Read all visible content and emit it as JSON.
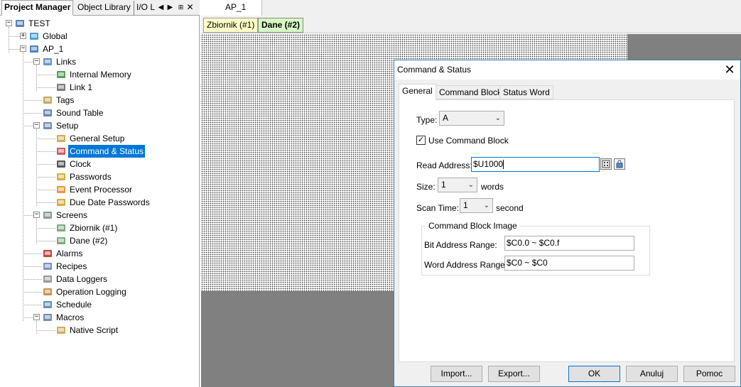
{
  "left_panel": {
    "tabs": [
      "Project Manager",
      "Object Library",
      "I/O L"
    ],
    "pin_glyph": "⌂",
    "tree": [
      {
        "label": "TEST",
        "expander": "−",
        "icon": "project-icon"
      },
      {
        "label": "Global",
        "expander": "+",
        "icon": "globe-icon"
      },
      {
        "label": "AP_1",
        "expander": "−",
        "icon": "monitor-icon"
      },
      {
        "label": "Links",
        "expander": "−",
        "icon": "links-icon"
      },
      {
        "label": "Internal Memory",
        "icon": "memory-icon"
      },
      {
        "label": "Link 1",
        "icon": "plc-icon"
      },
      {
        "label": "Tags",
        "icon": "tags-icon"
      },
      {
        "label": "Sound Table",
        "icon": "sound-icon"
      },
      {
        "label": "Setup",
        "expander": "−",
        "icon": "gears-icon"
      },
      {
        "label": "General Setup",
        "icon": "setup-icon"
      },
      {
        "label": "Command & Status",
        "icon": "command-icon",
        "selected": true
      },
      {
        "label": "Clock",
        "icon": "clock-icon"
      },
      {
        "label": "Passwords",
        "icon": "key-icon"
      },
      {
        "label": "Event Processor",
        "icon": "lightning-icon"
      },
      {
        "label": "Due Date Passwords",
        "icon": "key-icon"
      },
      {
        "label": "Screens",
        "expander": "−",
        "icon": "screens-icon"
      },
      {
        "label": "Zbiornik (#1)",
        "icon": "screen-icon"
      },
      {
        "label": "Dane (#2)",
        "icon": "screen-icon"
      },
      {
        "label": "Alarms",
        "icon": "alarm-icon"
      },
      {
        "label": "Recipes",
        "icon": "recipes-icon"
      },
      {
        "label": "Data Loggers",
        "icon": "logger-icon"
      },
      {
        "label": "Operation Logging",
        "icon": "oplog-icon"
      },
      {
        "label": "Schedule",
        "icon": "schedule-icon"
      },
      {
        "label": "Macros",
        "expander": "−",
        "icon": "macros-icon"
      },
      {
        "label": "Native Script",
        "icon": "script-icon"
      }
    ]
  },
  "document": {
    "tab": "AP_1",
    "screen_tabs": [
      "Zbiornik (#1)",
      "Dane (#2)"
    ]
  },
  "dialog": {
    "title": "Command & Status",
    "tabs": [
      "General",
      "Command Block",
      "Status Word"
    ],
    "type_label": "Type:",
    "type_value": "A",
    "use_command_block_label": "Use Command Block",
    "use_command_block_checked": true,
    "read_address_label": "Read Address:",
    "read_address_value": "$U1000",
    "size_label": "Size:",
    "size_value": "1",
    "size_unit": "words",
    "scan_time_label": "Scan Time:",
    "scan_time_value": "1",
    "scan_time_unit": "second",
    "group_title": "Command Block Image",
    "bit_range_label": "Bit Address Range:",
    "bit_range_value": "$C0.0 ~ $C0.f",
    "word_range_label": "Word Address Range:",
    "word_range_value": "$C0 ~ $C0",
    "buttons": {
      "import": "Import...",
      "export": "Export...",
      "ok": "OK",
      "cancel": "Anuluj",
      "help": "Pomoc"
    }
  },
  "colors": {
    "selection": "#0078d7",
    "zbiornik_tab": "#ffffc8",
    "dane_tab": "#d7f7c4"
  }
}
